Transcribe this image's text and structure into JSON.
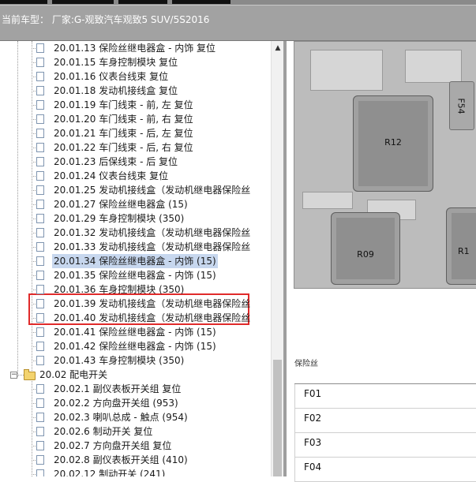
{
  "header": {
    "vehicle_text": "当前车型： 厂家:G-观致汽车观致5 SUV/5S2016"
  },
  "tree": {
    "items": [
      {
        "label": "20.01.13 保险丝继电器盒 - 内饰 复位",
        "selected": false
      },
      {
        "label": "20.01.15 车身控制模块 复位",
        "selected": false
      },
      {
        "label": "20.01.16 仪表台线束 复位",
        "selected": false
      },
      {
        "label": "20.01.18 发动机接线盒 复位",
        "selected": false
      },
      {
        "label": "20.01.19 车门线束 - 前, 左 复位",
        "selected": false
      },
      {
        "label": "20.01.20 车门线束 - 前, 右 复位",
        "selected": false
      },
      {
        "label": "20.01.21 车门线束 - 后, 左 复位",
        "selected": false
      },
      {
        "label": "20.01.22 车门线束 - 后, 右 复位",
        "selected": false
      },
      {
        "label": "20.01.23 后保线束 - 后 复位",
        "selected": false
      },
      {
        "label": "20.01.24 仪表台线束 复位",
        "selected": false
      },
      {
        "label": "20.01.25 发动机接线盒（发动机继电器保险丝",
        "selected": false
      },
      {
        "label": "20.01.27 保险丝继电器盒 (15)",
        "selected": false
      },
      {
        "label": "20.01.29 车身控制模块 (350)",
        "selected": false
      },
      {
        "label": "20.01.32 发动机接线盒（发动机继电器保险丝",
        "selected": false
      },
      {
        "label": "20.01.33 发动机接线盒（发动机继电器保险丝",
        "selected": false
      },
      {
        "label": "20.01.34 保险丝继电器盒 - 内饰 (15)",
        "selected": true
      },
      {
        "label": "20.01.35 保险丝继电器盒 - 内饰 (15)",
        "selected": false
      },
      {
        "label": "20.01.36 车身控制模块 (350)",
        "selected": false
      },
      {
        "label": "20.01.39 发动机接线盒（发动机继电器保险丝",
        "selected": false
      },
      {
        "label": "20.01.40 发动机接线盒（发动机继电器保险丝",
        "selected": false
      },
      {
        "label": "20.01.41 保险丝继电器盒 - 内饰 (15)",
        "selected": false
      },
      {
        "label": "20.01.42 保险丝继电器盒 - 内饰 (15)",
        "selected": false
      },
      {
        "label": "20.01.43 车身控制模块 (350)",
        "selected": false
      },
      {
        "label": "20.02 配电开关",
        "selected": false,
        "folder": true
      },
      {
        "label": "20.02.1 副仪表板开关组 复位",
        "selected": false
      },
      {
        "label": "20.02.2 方向盘开关组 (953)",
        "selected": false
      },
      {
        "label": "20.02.3 喇叭总成 - 触点 (954)",
        "selected": false
      },
      {
        "label": "20.02.6 制动开关 复位",
        "selected": false
      },
      {
        "label": "20.02.7 方向盘开关组 复位",
        "selected": false
      },
      {
        "label": "20.02.8 副仪表板开关组 (410)",
        "selected": false
      },
      {
        "label": "20.02.12 制动开关 (241)",
        "selected": false
      }
    ]
  },
  "diagram": {
    "components": [
      "R12",
      "R09",
      "R1",
      "F54"
    ]
  },
  "fuse_table": {
    "title": "保险丝",
    "rows": [
      "F01",
      "F02",
      "F03",
      "F04"
    ]
  },
  "colors": {
    "header_bg": "#a2a2a2",
    "selection_bg": "#c7d7ee",
    "highlight_border": "#e02a2a"
  },
  "icons": {
    "doc": "document-icon",
    "folder": "folder-icon",
    "expander": "collapse-icon",
    "scroll_up": "scroll-up-arrow-icon"
  }
}
